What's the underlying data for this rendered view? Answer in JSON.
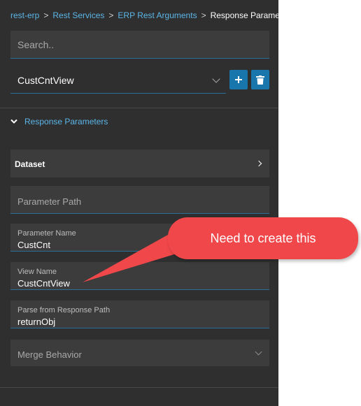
{
  "breadcrumb": {
    "items": [
      "rest-erp",
      "Rest Services",
      "ERP Rest Arguments"
    ],
    "current": "Response Parameters",
    "separator": ">"
  },
  "search": {
    "placeholder": "Search.."
  },
  "view_select": {
    "value": "CustCntView"
  },
  "section": {
    "title": "Response Parameters"
  },
  "dataset": {
    "label": "Dataset"
  },
  "fields": {
    "parameter_path": {
      "placeholder": "Parameter Path"
    },
    "parameter_name": {
      "label": "Parameter Name",
      "value": "CustCnt"
    },
    "view_name": {
      "label": "View Name",
      "value": "CustCntView"
    },
    "parse_path": {
      "label": "Parse from Response Path",
      "value": "returnObj"
    },
    "merge_behavior": {
      "placeholder": "Merge Behavior"
    }
  },
  "callout": {
    "text": "Need to create this"
  },
  "colors": {
    "panel": "#2f2f2f",
    "field": "#3c3c3c",
    "accent_link": "#5bb6e8",
    "button": "#1976ac",
    "underline": "#2a6f97",
    "callout": "#f0474a"
  },
  "icons": [
    "chevron-down-icon",
    "plus-icon",
    "trash-icon",
    "chevron-right-icon"
  ]
}
